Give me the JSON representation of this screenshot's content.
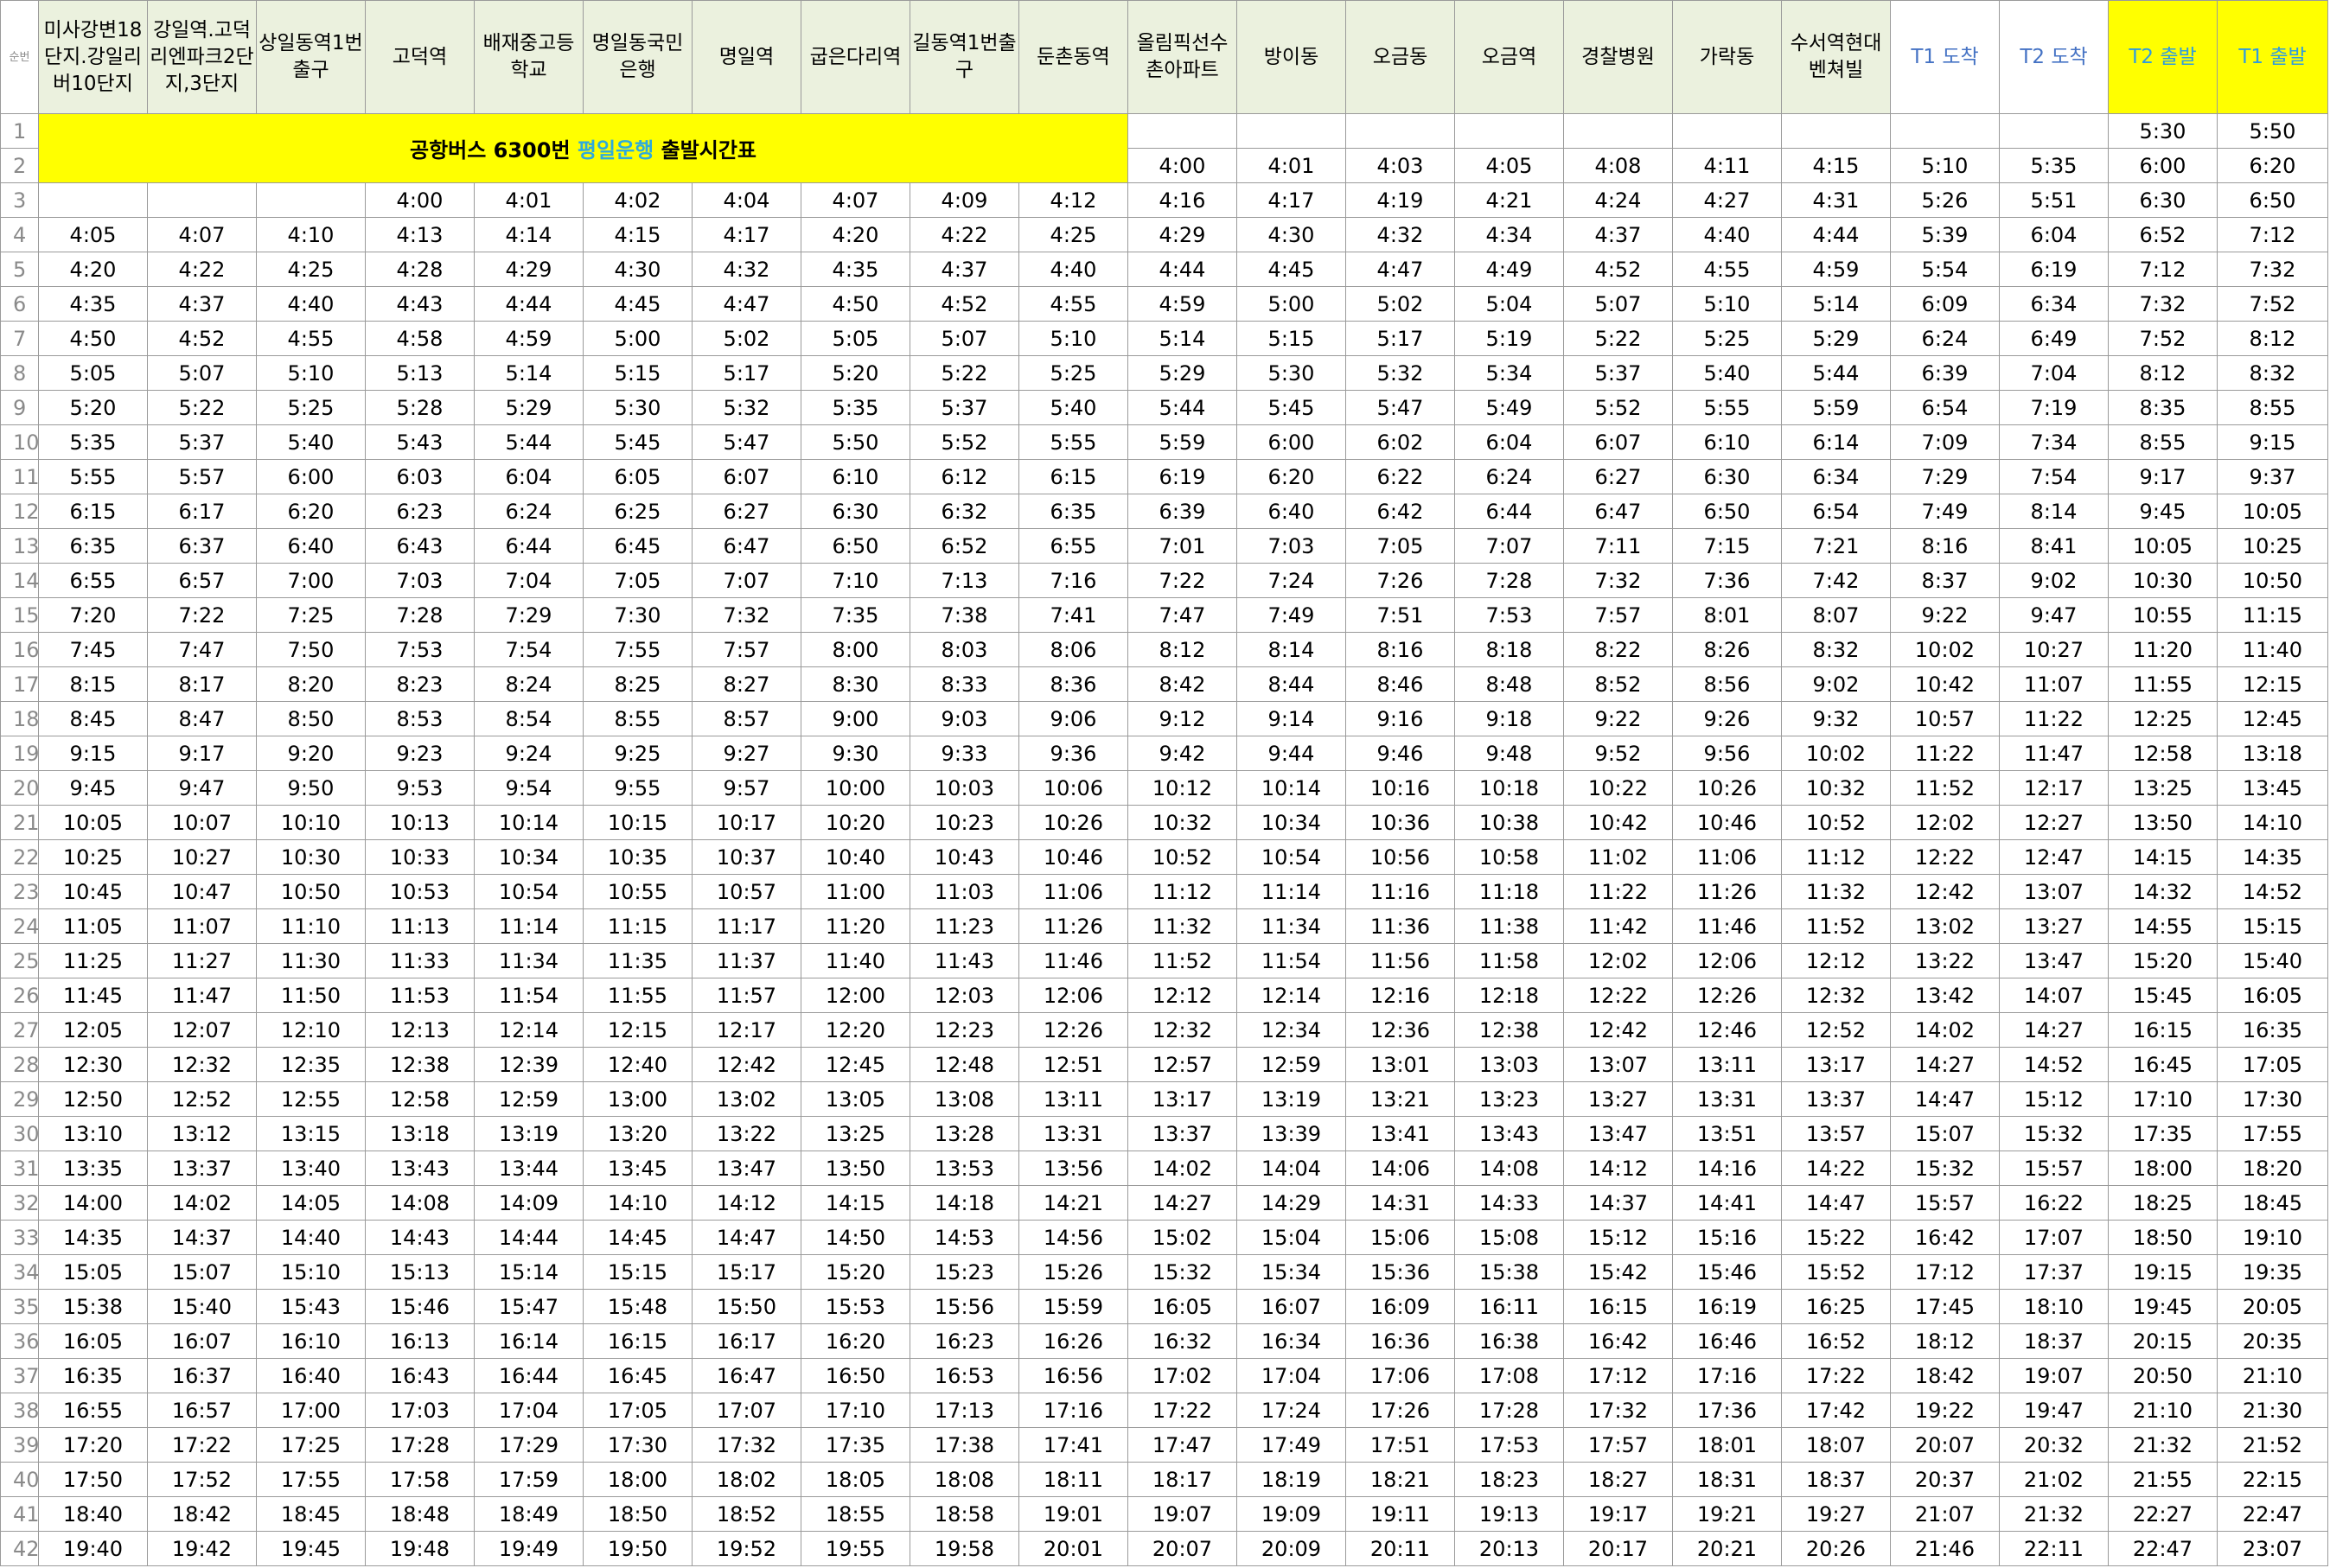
{
  "sheet": {
    "row_header_label": "순번",
    "title": {
      "prefix": "공항버스 6300번 ",
      "highlight": "평일운행",
      "suffix": " 출발시간표"
    },
    "columns": [
      {
        "label": "미사강변18단지.강일리버10단지",
        "style": "normal"
      },
      {
        "label": "강일역.고덕리엔파크2단지,3단지",
        "style": "normal"
      },
      {
        "label": "상일동역1번출구",
        "style": "normal"
      },
      {
        "label": "고덕역",
        "style": "normal"
      },
      {
        "label": "배재중고등학교",
        "style": "normal"
      },
      {
        "label": "명일동국민은행",
        "style": "normal"
      },
      {
        "label": "명일역",
        "style": "normal"
      },
      {
        "label": "굽은다리역",
        "style": "normal"
      },
      {
        "label": "길동역1번출구",
        "style": "normal"
      },
      {
        "label": "둔촌동역",
        "style": "normal"
      },
      {
        "label": "올림픽선수촌아파트",
        "style": "normal"
      },
      {
        "label": "방이동",
        "style": "normal"
      },
      {
        "label": "오금동",
        "style": "normal"
      },
      {
        "label": "오금역",
        "style": "normal"
      },
      {
        "label": "경찰병원",
        "style": "normal"
      },
      {
        "label": "가락동",
        "style": "normal"
      },
      {
        "label": "수서역현대벤쳐빌",
        "style": "normal"
      },
      {
        "label": "T1 도착",
        "style": "blue"
      },
      {
        "label": "T2 도착",
        "style": "blue"
      },
      {
        "label": "T2 출발",
        "style": "yellow"
      },
      {
        "label": "T1 출발",
        "style": "yellow"
      }
    ],
    "rows": [
      [
        "",
        "",
        "",
        "",
        "",
        "",
        "",
        "",
        "",
        "",
        "",
        "",
        "",
        "",
        "",
        "",
        "",
        "",
        "",
        "5:30",
        "5:50"
      ],
      [
        "",
        "",
        "",
        "",
        "",
        "",
        "",
        "",
        "",
        "",
        "4:00",
        "4:01",
        "4:03",
        "4:05",
        "4:08",
        "4:11",
        "4:15",
        "5:10",
        "5:35",
        "6:00",
        "6:20"
      ],
      [
        "",
        "",
        "",
        "4:00",
        "4:01",
        "4:02",
        "4:04",
        "4:07",
        "4:09",
        "4:12",
        "4:16",
        "4:17",
        "4:19",
        "4:21",
        "4:24",
        "4:27",
        "4:31",
        "5:26",
        "5:51",
        "6:30",
        "6:50"
      ],
      [
        "4:05",
        "4:07",
        "4:10",
        "4:13",
        "4:14",
        "4:15",
        "4:17",
        "4:20",
        "4:22",
        "4:25",
        "4:29",
        "4:30",
        "4:32",
        "4:34",
        "4:37",
        "4:40",
        "4:44",
        "5:39",
        "6:04",
        "6:52",
        "7:12"
      ],
      [
        "4:20",
        "4:22",
        "4:25",
        "4:28",
        "4:29",
        "4:30",
        "4:32",
        "4:35",
        "4:37",
        "4:40",
        "4:44",
        "4:45",
        "4:47",
        "4:49",
        "4:52",
        "4:55",
        "4:59",
        "5:54",
        "6:19",
        "7:12",
        "7:32"
      ],
      [
        "4:35",
        "4:37",
        "4:40",
        "4:43",
        "4:44",
        "4:45",
        "4:47",
        "4:50",
        "4:52",
        "4:55",
        "4:59",
        "5:00",
        "5:02",
        "5:04",
        "5:07",
        "5:10",
        "5:14",
        "6:09",
        "6:34",
        "7:32",
        "7:52"
      ],
      [
        "4:50",
        "4:52",
        "4:55",
        "4:58",
        "4:59",
        "5:00",
        "5:02",
        "5:05",
        "5:07",
        "5:10",
        "5:14",
        "5:15",
        "5:17",
        "5:19",
        "5:22",
        "5:25",
        "5:29",
        "6:24",
        "6:49",
        "7:52",
        "8:12"
      ],
      [
        "5:05",
        "5:07",
        "5:10",
        "5:13",
        "5:14",
        "5:15",
        "5:17",
        "5:20",
        "5:22",
        "5:25",
        "5:29",
        "5:30",
        "5:32",
        "5:34",
        "5:37",
        "5:40",
        "5:44",
        "6:39",
        "7:04",
        "8:12",
        "8:32"
      ],
      [
        "5:20",
        "5:22",
        "5:25",
        "5:28",
        "5:29",
        "5:30",
        "5:32",
        "5:35",
        "5:37",
        "5:40",
        "5:44",
        "5:45",
        "5:47",
        "5:49",
        "5:52",
        "5:55",
        "5:59",
        "6:54",
        "7:19",
        "8:35",
        "8:55"
      ],
      [
        "5:35",
        "5:37",
        "5:40",
        "5:43",
        "5:44",
        "5:45",
        "5:47",
        "5:50",
        "5:52",
        "5:55",
        "5:59",
        "6:00",
        "6:02",
        "6:04",
        "6:07",
        "6:10",
        "6:14",
        "7:09",
        "7:34",
        "8:55",
        "9:15"
      ],
      [
        "5:55",
        "5:57",
        "6:00",
        "6:03",
        "6:04",
        "6:05",
        "6:07",
        "6:10",
        "6:12",
        "6:15",
        "6:19",
        "6:20",
        "6:22",
        "6:24",
        "6:27",
        "6:30",
        "6:34",
        "7:29",
        "7:54",
        "9:17",
        "9:37"
      ],
      [
        "6:15",
        "6:17",
        "6:20",
        "6:23",
        "6:24",
        "6:25",
        "6:27",
        "6:30",
        "6:32",
        "6:35",
        "6:39",
        "6:40",
        "6:42",
        "6:44",
        "6:47",
        "6:50",
        "6:54",
        "7:49",
        "8:14",
        "9:45",
        "10:05"
      ],
      [
        "6:35",
        "6:37",
        "6:40",
        "6:43",
        "6:44",
        "6:45",
        "6:47",
        "6:50",
        "6:52",
        "6:55",
        "7:01",
        "7:03",
        "7:05",
        "7:07",
        "7:11",
        "7:15",
        "7:21",
        "8:16",
        "8:41",
        "10:05",
        "10:25"
      ],
      [
        "6:55",
        "6:57",
        "7:00",
        "7:03",
        "7:04",
        "7:05",
        "7:07",
        "7:10",
        "7:13",
        "7:16",
        "7:22",
        "7:24",
        "7:26",
        "7:28",
        "7:32",
        "7:36",
        "7:42",
        "8:37",
        "9:02",
        "10:30",
        "10:50"
      ],
      [
        "7:20",
        "7:22",
        "7:25",
        "7:28",
        "7:29",
        "7:30",
        "7:32",
        "7:35",
        "7:38",
        "7:41",
        "7:47",
        "7:49",
        "7:51",
        "7:53",
        "7:57",
        "8:01",
        "8:07",
        "9:22",
        "9:47",
        "10:55",
        "11:15"
      ],
      [
        "7:45",
        "7:47",
        "7:50",
        "7:53",
        "7:54",
        "7:55",
        "7:57",
        "8:00",
        "8:03",
        "8:06",
        "8:12",
        "8:14",
        "8:16",
        "8:18",
        "8:22",
        "8:26",
        "8:32",
        "10:02",
        "10:27",
        "11:20",
        "11:40"
      ],
      [
        "8:15",
        "8:17",
        "8:20",
        "8:23",
        "8:24",
        "8:25",
        "8:27",
        "8:30",
        "8:33",
        "8:36",
        "8:42",
        "8:44",
        "8:46",
        "8:48",
        "8:52",
        "8:56",
        "9:02",
        "10:42",
        "11:07",
        "11:55",
        "12:15"
      ],
      [
        "8:45",
        "8:47",
        "8:50",
        "8:53",
        "8:54",
        "8:55",
        "8:57",
        "9:00",
        "9:03",
        "9:06",
        "9:12",
        "9:14",
        "9:16",
        "9:18",
        "9:22",
        "9:26",
        "9:32",
        "10:57",
        "11:22",
        "12:25",
        "12:45"
      ],
      [
        "9:15",
        "9:17",
        "9:20",
        "9:23",
        "9:24",
        "9:25",
        "9:27",
        "9:30",
        "9:33",
        "9:36",
        "9:42",
        "9:44",
        "9:46",
        "9:48",
        "9:52",
        "9:56",
        "10:02",
        "11:22",
        "11:47",
        "12:58",
        "13:18"
      ],
      [
        "9:45",
        "9:47",
        "9:50",
        "9:53",
        "9:54",
        "9:55",
        "9:57",
        "10:00",
        "10:03",
        "10:06",
        "10:12",
        "10:14",
        "10:16",
        "10:18",
        "10:22",
        "10:26",
        "10:32",
        "11:52",
        "12:17",
        "13:25",
        "13:45"
      ],
      [
        "10:05",
        "10:07",
        "10:10",
        "10:13",
        "10:14",
        "10:15",
        "10:17",
        "10:20",
        "10:23",
        "10:26",
        "10:32",
        "10:34",
        "10:36",
        "10:38",
        "10:42",
        "10:46",
        "10:52",
        "12:02",
        "12:27",
        "13:50",
        "14:10"
      ],
      [
        "10:25",
        "10:27",
        "10:30",
        "10:33",
        "10:34",
        "10:35",
        "10:37",
        "10:40",
        "10:43",
        "10:46",
        "10:52",
        "10:54",
        "10:56",
        "10:58",
        "11:02",
        "11:06",
        "11:12",
        "12:22",
        "12:47",
        "14:15",
        "14:35"
      ],
      [
        "10:45",
        "10:47",
        "10:50",
        "10:53",
        "10:54",
        "10:55",
        "10:57",
        "11:00",
        "11:03",
        "11:06",
        "11:12",
        "11:14",
        "11:16",
        "11:18",
        "11:22",
        "11:26",
        "11:32",
        "12:42",
        "13:07",
        "14:32",
        "14:52"
      ],
      [
        "11:05",
        "11:07",
        "11:10",
        "11:13",
        "11:14",
        "11:15",
        "11:17",
        "11:20",
        "11:23",
        "11:26",
        "11:32",
        "11:34",
        "11:36",
        "11:38",
        "11:42",
        "11:46",
        "11:52",
        "13:02",
        "13:27",
        "14:55",
        "15:15"
      ],
      [
        "11:25",
        "11:27",
        "11:30",
        "11:33",
        "11:34",
        "11:35",
        "11:37",
        "11:40",
        "11:43",
        "11:46",
        "11:52",
        "11:54",
        "11:56",
        "11:58",
        "12:02",
        "12:06",
        "12:12",
        "13:22",
        "13:47",
        "15:20",
        "15:40"
      ],
      [
        "11:45",
        "11:47",
        "11:50",
        "11:53",
        "11:54",
        "11:55",
        "11:57",
        "12:00",
        "12:03",
        "12:06",
        "12:12",
        "12:14",
        "12:16",
        "12:18",
        "12:22",
        "12:26",
        "12:32",
        "13:42",
        "14:07",
        "15:45",
        "16:05"
      ],
      [
        "12:05",
        "12:07",
        "12:10",
        "12:13",
        "12:14",
        "12:15",
        "12:17",
        "12:20",
        "12:23",
        "12:26",
        "12:32",
        "12:34",
        "12:36",
        "12:38",
        "12:42",
        "12:46",
        "12:52",
        "14:02",
        "14:27",
        "16:15",
        "16:35"
      ],
      [
        "12:30",
        "12:32",
        "12:35",
        "12:38",
        "12:39",
        "12:40",
        "12:42",
        "12:45",
        "12:48",
        "12:51",
        "12:57",
        "12:59",
        "13:01",
        "13:03",
        "13:07",
        "13:11",
        "13:17",
        "14:27",
        "14:52",
        "16:45",
        "17:05"
      ],
      [
        "12:50",
        "12:52",
        "12:55",
        "12:58",
        "12:59",
        "13:00",
        "13:02",
        "13:05",
        "13:08",
        "13:11",
        "13:17",
        "13:19",
        "13:21",
        "13:23",
        "13:27",
        "13:31",
        "13:37",
        "14:47",
        "15:12",
        "17:10",
        "17:30"
      ],
      [
        "13:10",
        "13:12",
        "13:15",
        "13:18",
        "13:19",
        "13:20",
        "13:22",
        "13:25",
        "13:28",
        "13:31",
        "13:37",
        "13:39",
        "13:41",
        "13:43",
        "13:47",
        "13:51",
        "13:57",
        "15:07",
        "15:32",
        "17:35",
        "17:55"
      ],
      [
        "13:35",
        "13:37",
        "13:40",
        "13:43",
        "13:44",
        "13:45",
        "13:47",
        "13:50",
        "13:53",
        "13:56",
        "14:02",
        "14:04",
        "14:06",
        "14:08",
        "14:12",
        "14:16",
        "14:22",
        "15:32",
        "15:57",
        "18:00",
        "18:20"
      ],
      [
        "14:00",
        "14:02",
        "14:05",
        "14:08",
        "14:09",
        "14:10",
        "14:12",
        "14:15",
        "14:18",
        "14:21",
        "14:27",
        "14:29",
        "14:31",
        "14:33",
        "14:37",
        "14:41",
        "14:47",
        "15:57",
        "16:22",
        "18:25",
        "18:45"
      ],
      [
        "14:35",
        "14:37",
        "14:40",
        "14:43",
        "14:44",
        "14:45",
        "14:47",
        "14:50",
        "14:53",
        "14:56",
        "15:02",
        "15:04",
        "15:06",
        "15:08",
        "15:12",
        "15:16",
        "15:22",
        "16:42",
        "17:07",
        "18:50",
        "19:10"
      ],
      [
        "15:05",
        "15:07",
        "15:10",
        "15:13",
        "15:14",
        "15:15",
        "15:17",
        "15:20",
        "15:23",
        "15:26",
        "15:32",
        "15:34",
        "15:36",
        "15:38",
        "15:42",
        "15:46",
        "15:52",
        "17:12",
        "17:37",
        "19:15",
        "19:35"
      ],
      [
        "15:38",
        "15:40",
        "15:43",
        "15:46",
        "15:47",
        "15:48",
        "15:50",
        "15:53",
        "15:56",
        "15:59",
        "16:05",
        "16:07",
        "16:09",
        "16:11",
        "16:15",
        "16:19",
        "16:25",
        "17:45",
        "18:10",
        "19:45",
        "20:05"
      ],
      [
        "16:05",
        "16:07",
        "16:10",
        "16:13",
        "16:14",
        "16:15",
        "16:17",
        "16:20",
        "16:23",
        "16:26",
        "16:32",
        "16:34",
        "16:36",
        "16:38",
        "16:42",
        "16:46",
        "16:52",
        "18:12",
        "18:37",
        "20:15",
        "20:35"
      ],
      [
        "16:35",
        "16:37",
        "16:40",
        "16:43",
        "16:44",
        "16:45",
        "16:47",
        "16:50",
        "16:53",
        "16:56",
        "17:02",
        "17:04",
        "17:06",
        "17:08",
        "17:12",
        "17:16",
        "17:22",
        "18:42",
        "19:07",
        "20:50",
        "21:10"
      ],
      [
        "16:55",
        "16:57",
        "17:00",
        "17:03",
        "17:04",
        "17:05",
        "17:07",
        "17:10",
        "17:13",
        "17:16",
        "17:22",
        "17:24",
        "17:26",
        "17:28",
        "17:32",
        "17:36",
        "17:42",
        "19:22",
        "19:47",
        "21:10",
        "21:30"
      ],
      [
        "17:20",
        "17:22",
        "17:25",
        "17:28",
        "17:29",
        "17:30",
        "17:32",
        "17:35",
        "17:38",
        "17:41",
        "17:47",
        "17:49",
        "17:51",
        "17:53",
        "17:57",
        "18:01",
        "18:07",
        "20:07",
        "20:32",
        "21:32",
        "21:52"
      ],
      [
        "17:50",
        "17:52",
        "17:55",
        "17:58",
        "17:59",
        "18:00",
        "18:02",
        "18:05",
        "18:08",
        "18:11",
        "18:17",
        "18:19",
        "18:21",
        "18:23",
        "18:27",
        "18:31",
        "18:37",
        "20:37",
        "21:02",
        "21:55",
        "22:15"
      ],
      [
        "18:40",
        "18:42",
        "18:45",
        "18:48",
        "18:49",
        "18:50",
        "18:52",
        "18:55",
        "18:58",
        "19:01",
        "19:07",
        "19:09",
        "19:11",
        "19:13",
        "19:17",
        "19:21",
        "19:27",
        "21:07",
        "21:32",
        "22:27",
        "22:47"
      ],
      [
        "19:40",
        "19:42",
        "19:45",
        "19:48",
        "19:49",
        "19:50",
        "19:52",
        "19:55",
        "19:58",
        "20:01",
        "20:07",
        "20:09",
        "20:11",
        "20:13",
        "20:17",
        "20:21",
        "20:26",
        "21:46",
        "22:11",
        "22:47",
        "23:07"
      ]
    ]
  }
}
